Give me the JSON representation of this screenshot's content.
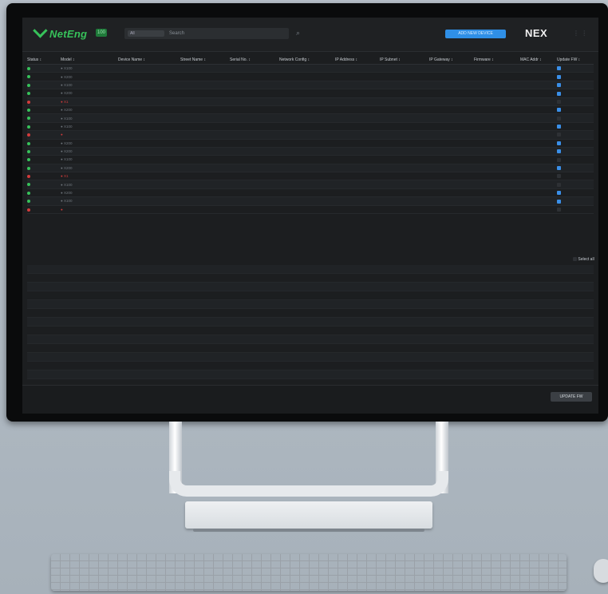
{
  "topbar": {
    "logo_text": "NetEng",
    "badge": "100",
    "search_filter": "All",
    "search_placeholder": "Search",
    "primary_button": "ADD NEW DEVICE",
    "brand": "NEX",
    "right_icons": "⋮ ⋮"
  },
  "table": {
    "columns": [
      "Status",
      "Model",
      "Device Name",
      "Street Name",
      "Serial No.",
      "Network Config",
      "IP Address",
      "IP Subnet",
      "IP Gateway",
      "Firmware",
      "MAC Addr",
      "Update FW"
    ],
    "rows": [
      {
        "status": "green",
        "model": "● X100",
        "name": "",
        "street": "",
        "serial": "",
        "config": "",
        "ip": "",
        "subnet": "",
        "gateway": "",
        "fw": "",
        "mac": "",
        "upd": "checked"
      },
      {
        "status": "green",
        "model": "● X200",
        "name": "",
        "street": "",
        "serial": "",
        "config": "",
        "ip": "",
        "subnet": "",
        "gateway": "",
        "fw": "",
        "mac": "",
        "upd": "checked"
      },
      {
        "status": "green",
        "model": "● X100",
        "name": "",
        "street": "",
        "serial": "",
        "config": "",
        "ip": "",
        "subnet": "",
        "gateway": "",
        "fw": "",
        "mac": "",
        "upd": "checked"
      },
      {
        "status": "green",
        "model": "● X200",
        "name": "",
        "street": "",
        "serial": "",
        "config": "",
        "ip": "",
        "subnet": "",
        "gateway": "",
        "fw": "",
        "mac": "",
        "upd": "checked"
      },
      {
        "status": "red",
        "model": "● X1",
        "name": "",
        "street": "",
        "serial": "",
        "config": "",
        "ip": "",
        "subnet": "",
        "gateway": "",
        "fw": "",
        "mac": "",
        "upd": "empty"
      },
      {
        "status": "green",
        "model": "● X200",
        "name": "",
        "street": "",
        "serial": "",
        "config": "",
        "ip": "",
        "subnet": "",
        "gateway": "",
        "fw": "",
        "mac": "",
        "upd": "checked"
      },
      {
        "status": "green",
        "model": "● X100",
        "name": "",
        "street": "",
        "serial": "",
        "config": "",
        "ip": "",
        "subnet": "",
        "gateway": "",
        "fw": "",
        "mac": "",
        "upd": "empty"
      },
      {
        "status": "green",
        "model": "● X100",
        "name": "",
        "street": "",
        "serial": "",
        "config": "",
        "ip": "",
        "subnet": "",
        "gateway": "",
        "fw": "",
        "mac": "",
        "upd": "checked"
      },
      {
        "status": "red",
        "model": "●",
        "name": "",
        "street": "",
        "serial": "",
        "config": "",
        "ip": "",
        "subnet": "",
        "gateway": "",
        "fw": "",
        "mac": "",
        "upd": "empty"
      },
      {
        "status": "green",
        "model": "● X200",
        "name": "",
        "street": "",
        "serial": "",
        "config": "",
        "ip": "",
        "subnet": "",
        "gateway": "",
        "fw": "",
        "mac": "",
        "upd": "checked"
      },
      {
        "status": "green",
        "model": "● X200",
        "name": "",
        "street": "",
        "serial": "",
        "config": "",
        "ip": "",
        "subnet": "",
        "gateway": "",
        "fw": "",
        "mac": "",
        "upd": "checked"
      },
      {
        "status": "green",
        "model": "● X100",
        "name": "",
        "street": "",
        "serial": "",
        "config": "",
        "ip": "",
        "subnet": "",
        "gateway": "",
        "fw": "",
        "mac": "",
        "upd": "empty"
      },
      {
        "status": "green",
        "model": "● X200",
        "name": "",
        "street": "",
        "serial": "",
        "config": "",
        "ip": "",
        "subnet": "",
        "gateway": "",
        "fw": "",
        "mac": "",
        "upd": "checked"
      },
      {
        "status": "red",
        "model": "● X1",
        "name": "",
        "street": "",
        "serial": "",
        "config": "",
        "ip": "",
        "subnet": "",
        "gateway": "",
        "fw": "",
        "mac": "",
        "upd": "empty"
      },
      {
        "status": "green",
        "model": "● X100",
        "name": "",
        "street": "",
        "serial": "",
        "config": "",
        "ip": "",
        "subnet": "",
        "gateway": "",
        "fw": "",
        "mac": "",
        "upd": "empty"
      },
      {
        "status": "green",
        "model": "● X200",
        "name": "",
        "street": "",
        "serial": "",
        "config": "",
        "ip": "",
        "subnet": "",
        "gateway": "",
        "fw": "",
        "mac": "",
        "upd": "checked"
      },
      {
        "status": "green",
        "model": "● X100",
        "name": "",
        "street": "",
        "serial": "",
        "config": "",
        "ip": "",
        "subnet": "",
        "gateway": "",
        "fw": "",
        "mac": "",
        "upd": "checked"
      },
      {
        "status": "red",
        "model": "●",
        "name": "",
        "street": "",
        "serial": "",
        "config": "",
        "ip": "",
        "subnet": "",
        "gateway": "",
        "fw": "",
        "mac": "",
        "upd": "empty"
      }
    ],
    "select_all": "Select all"
  },
  "bottom_bar": {
    "button": "UPDATE FW"
  },
  "colors": {
    "accent": "#2f8fe6",
    "ok": "#37c25a",
    "alert": "#d23b3b"
  }
}
